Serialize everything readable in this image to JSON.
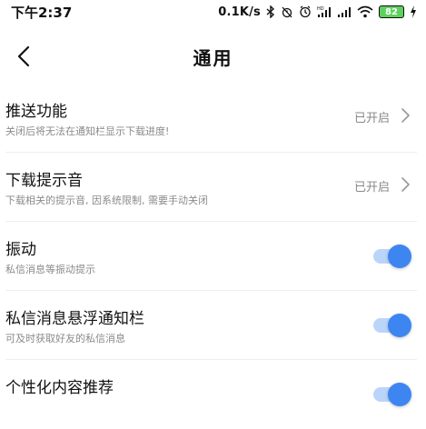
{
  "status_bar": {
    "time": "下午2:37",
    "speed": "0.1K/s",
    "battery": "82",
    "icons": [
      "bluetooth-icon",
      "alarm-off-icon",
      "clock-icon",
      "hd-signal-icon",
      "signal-icon",
      "wifi-icon",
      "battery-icon",
      "charging-icon"
    ]
  },
  "header": {
    "title": "通用",
    "back_icon": "chevron-left-icon"
  },
  "colors": {
    "accent": "#3d86f2",
    "value_text": "#888888",
    "subtitle_text": "#8a8a8a",
    "divider": "#eeeeee"
  },
  "settings": [
    {
      "title": "推送功能",
      "subtitle": "关闭后将无法在通知栏显示下载进度!",
      "value": "已开启",
      "control": "chevron"
    },
    {
      "title": "下载提示音",
      "subtitle": "下载相关的提示音, 因系统限制, 需要手动关闭",
      "value": "已开启",
      "control": "chevron"
    },
    {
      "title": "振动",
      "subtitle": "私信消息等振动提示",
      "control": "toggle",
      "on": true
    },
    {
      "title": "私信消息悬浮通知栏",
      "subtitle": "可及时获取好友的私信消息",
      "control": "toggle",
      "on": true
    },
    {
      "title": "个性化内容推荐",
      "subtitle": "",
      "control": "toggle",
      "on": true
    }
  ]
}
